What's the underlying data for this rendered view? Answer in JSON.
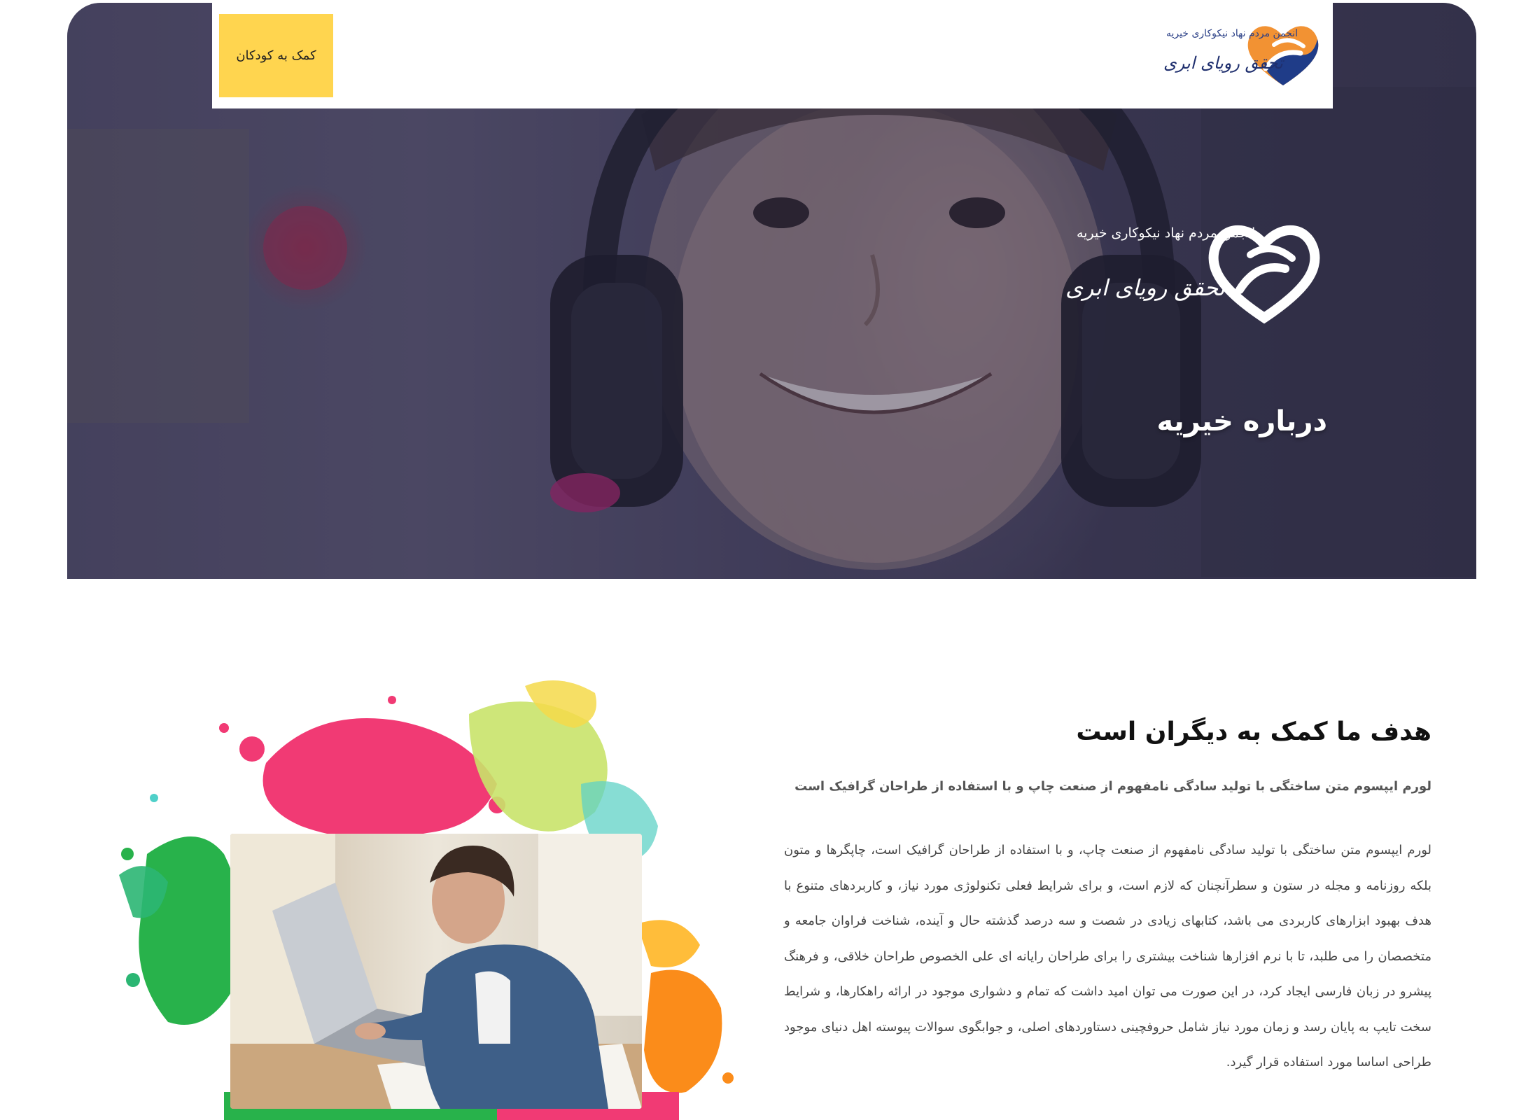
{
  "header": {
    "help_button_label": "کمک به کودکان",
    "brand": {
      "tagline": "انجمن مردم نهاد نیکوکاری خیریه",
      "name": "تحقق رویای ابری"
    }
  },
  "hero": {
    "brand": {
      "tagline": "انجمن مردم نهاد نیکوکاری خیریه",
      "name": "تحقق رویای ابری"
    },
    "title": "درباره خیریه"
  },
  "about": {
    "heading": "هدف ما کمک به دیگران است",
    "subheading": "لورم ایپسوم متن ساختگی با تولید سادگی نامفهوم از صنعت چاپ و با استفاده از طراحان گرافیک است",
    "body": "لورم ایپسوم متن ساختگی با تولید سادگی نامفهوم از صنعت چاپ، و با استفاده از طراحان گرافیک است، چاپگرها و متون بلکه روزنامه و مجله در ستون و سطرآنچنان که لازم است، و برای شرایط فعلی تکنولوژی مورد نیاز، و کاربردهای متنوع با هدف بهبود ابزارهای کاربردی می باشد، کتابهای زیادی در شصت و سه درصد گذشته حال و آینده، شناخت فراوان جامعه و متخصصان را می طلبد، تا با نرم افزارها شناخت بیشتری را برای طراحان رایانه ای علی الخصوص طراحان خلاقی، و فرهنگ پیشرو در زبان فارسی ایجاد کرد، در این صورت می توان امید داشت که تمام و دشواری موجود در ارائه راهکارها، و شرایط سخت تایپ به پایان رسد و زمان مورد نیاز شامل حروفچینی دستاوردهای اصلی، و جوابگوی سوالات پیوسته اهل دنیای موجود طراحی اساسا مورد استفاده قرار گیرد."
  },
  "colors": {
    "accent_button": "#ffd54f",
    "brand_blue": "#1f3c88",
    "brand_orange": "#f29233",
    "hero_overlay": "#2f2b4a"
  },
  "icons": {
    "brand_logo": "heart-hand-icon"
  }
}
